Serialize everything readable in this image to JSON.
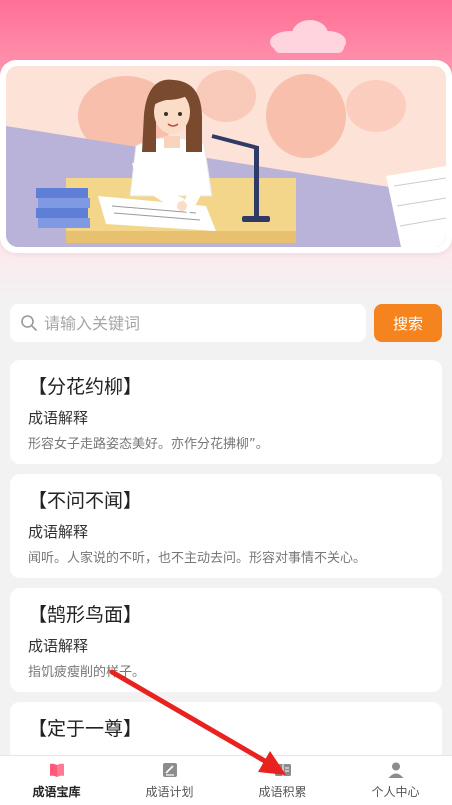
{
  "search": {
    "placeholder": "请输入关键词",
    "button_label": "搜索"
  },
  "idioms": [
    {
      "title": "【分花约柳】",
      "subtitle": "成语解释",
      "description": "形容女子走路姿态美好。亦作分花拂柳”。"
    },
    {
      "title": "【不问不闻】",
      "subtitle": "成语解释",
      "description": "闻听。人家说的不听，也不主动去问。形容对事情不关心。"
    },
    {
      "title": "【鹄形鸟面】",
      "subtitle": "成语解释",
      "description": "指饥疲瘦削的样子。"
    },
    {
      "title": "【定于一尊】",
      "subtitle": "",
      "description": ""
    }
  ],
  "tabbar": {
    "tabs": [
      {
        "label": "成语宝库",
        "icon": "book-icon",
        "active": true
      },
      {
        "label": "成语计划",
        "icon": "plan-icon",
        "active": false
      },
      {
        "label": "成语积累",
        "icon": "notebook-icon",
        "active": false
      },
      {
        "label": "个人中心",
        "icon": "person-icon",
        "active": false
      }
    ]
  },
  "colors": {
    "header_pink": "#ff6f95",
    "accent_orange": "#f5841f",
    "active_tab_icon": "#ff5a7a",
    "annotation_arrow": "#e8231f"
  }
}
